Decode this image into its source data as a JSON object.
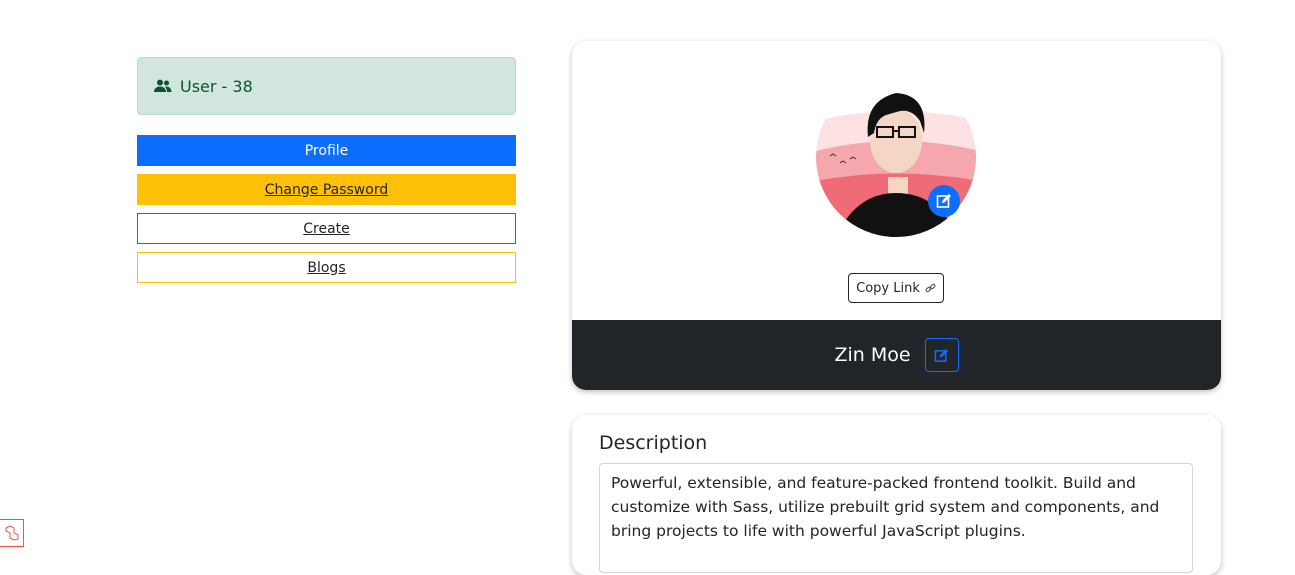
{
  "sidebar": {
    "user_label": "User - 38",
    "buttons": {
      "profile": "Profile",
      "change_password": "Change Password",
      "create": "Create",
      "blogs": "Blogs"
    }
  },
  "profile_card": {
    "copy_link_label": "Copy Link",
    "name": "Zin Moe"
  },
  "description": {
    "title": "Description",
    "text": "Powerful, extensible, and feature-packed frontend toolkit. Build and customize with Sass, utilize prebuilt grid system and components, and bring projects to life with powerful JavaScript plugins."
  },
  "colors": {
    "primary": "#0d6efd",
    "warning": "#ffc107",
    "success": "#198754",
    "dark": "#212529",
    "alert_success_bg": "#d1e7dd"
  },
  "icons": {
    "user": "users-icon",
    "edit": "edit-icon",
    "link": "link-icon"
  }
}
